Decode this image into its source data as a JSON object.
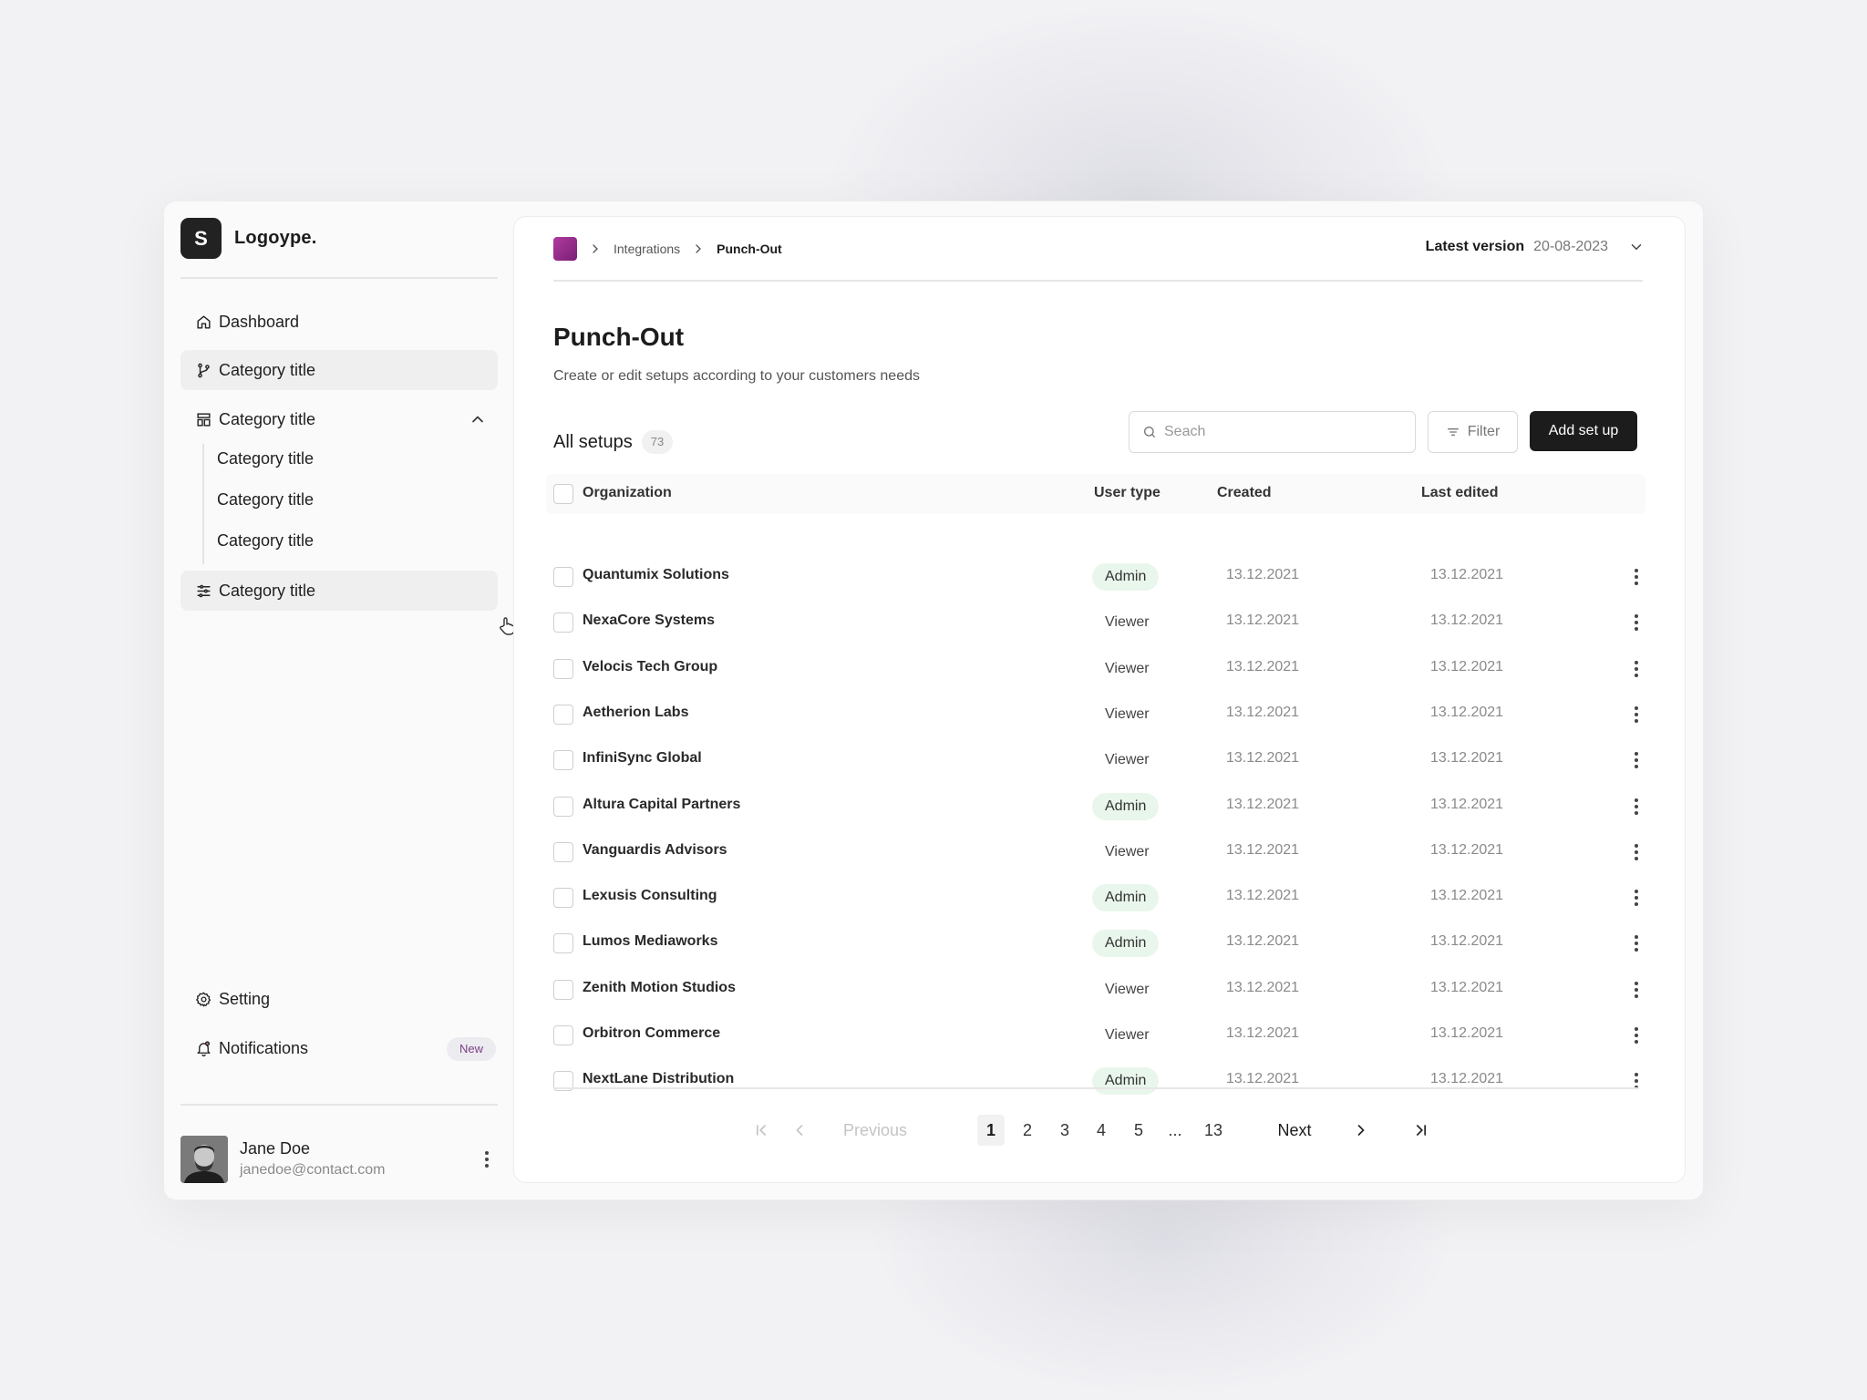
{
  "brand": {
    "mark": "S",
    "name": "Logoype."
  },
  "sidebar": {
    "dashboard": "Dashboard",
    "items": [
      "Category title",
      "Category title",
      "Category title"
    ],
    "sub_items": [
      "Category title",
      "Category title",
      "Category title"
    ],
    "setting": "Setting",
    "notifications": "Notifications",
    "notifications_badge": "New"
  },
  "user": {
    "name": "Jane Doe",
    "email": "janedoe@contact.com"
  },
  "breadcrumb": {
    "items": [
      "Integrations",
      "Punch-Out"
    ]
  },
  "version": {
    "label": "Latest version",
    "value": "20-08-2023"
  },
  "page": {
    "title": "Punch-Out",
    "subtitle": "Create or edit setups according to your customers needs",
    "section_title": "All setups",
    "count": "73"
  },
  "toolbar": {
    "search_placeholder": "Seach",
    "filter_label": "Filter",
    "add_label": "Add set up"
  },
  "table": {
    "columns": [
      "Organization",
      "User type",
      "Created",
      "Last edited"
    ],
    "rows": [
      {
        "org": "Quantumix Solutions",
        "type": "Admin",
        "created": "13.12.2021",
        "edited": "13.12.2021"
      },
      {
        "org": "NexaCore Systems",
        "type": "Viewer",
        "created": "13.12.2021",
        "edited": "13.12.2021"
      },
      {
        "org": "Velocis Tech Group",
        "type": "Viewer",
        "created": "13.12.2021",
        "edited": "13.12.2021"
      },
      {
        "org": "Aetherion Labs",
        "type": "Viewer",
        "created": "13.12.2021",
        "edited": "13.12.2021"
      },
      {
        "org": "InfiniSync Global",
        "type": "Viewer",
        "created": "13.12.2021",
        "edited": "13.12.2021"
      },
      {
        "org": "Altura Capital Partners",
        "type": "Admin",
        "created": "13.12.2021",
        "edited": "13.12.2021"
      },
      {
        "org": "Vanguardis Advisors",
        "type": "Viewer",
        "created": "13.12.2021",
        "edited": "13.12.2021"
      },
      {
        "org": "Lexusis Consulting",
        "type": "Admin",
        "created": "13.12.2021",
        "edited": "13.12.2021"
      },
      {
        "org": "Lumos Mediaworks",
        "type": "Admin",
        "created": "13.12.2021",
        "edited": "13.12.2021"
      },
      {
        "org": "Zenith Motion Studios",
        "type": "Viewer",
        "created": "13.12.2021",
        "edited": "13.12.2021"
      },
      {
        "org": "Orbitron Commerce",
        "type": "Viewer",
        "created": "13.12.2021",
        "edited": "13.12.2021"
      },
      {
        "org": "NextLane Distribution",
        "type": "Admin",
        "created": "13.12.2021",
        "edited": "13.12.2021"
      }
    ]
  },
  "pagination": {
    "previous": "Previous",
    "next": "Next",
    "pages": [
      "1",
      "2",
      "3",
      "4",
      "5",
      "...",
      "13"
    ],
    "current": "1"
  },
  "colors": {
    "accent": "#1c1c1c",
    "admin_badge": "#e9f6ec",
    "brand_badge": "#9b2f8f",
    "new_badge_text": "#7b3f85"
  }
}
